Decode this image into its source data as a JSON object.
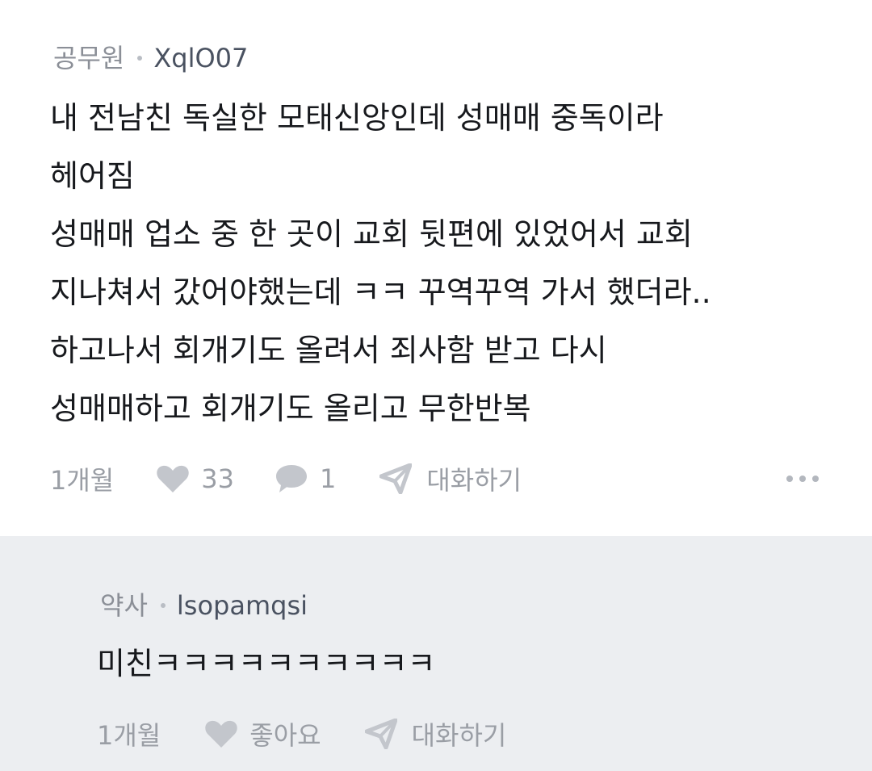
{
  "post": {
    "author_job": "공무원",
    "author_nick": "XqlO07",
    "lines": [
      "내 전남친 독실한 모태신앙인데 성매매 중독이라",
      "헤어짐",
      "성매매 업소 중 한 곳이 교회 뒷편에 있었어서 교회",
      "지나쳐서 갔어야했는데 ㅋㅋ 꾸역꾸역 가서 했더라..",
      "하고나서 회개기도 올려서 죄사함 받고 다시",
      "성매매하고 회개기도 올리고 무한반복"
    ],
    "time": "1개월",
    "likes": "33",
    "comments": "1",
    "chat_label": "대화하기",
    "icons": [
      "heart-icon",
      "comment-bubble-icon",
      "send-icon",
      "more-dots-icon"
    ]
  },
  "reply": {
    "author_job": "약사",
    "author_nick": "lsopamqsi",
    "text": "미친ㅋㅋㅋㅋㅋㅋㅋㅋㅋㅋ",
    "time": "1개월",
    "like_label": "좋아요",
    "chat_label": "대화하기",
    "icons": [
      "heart-icon",
      "send-icon"
    ]
  },
  "colors": {
    "background": "#ffffff",
    "reply_background": "#eceef1",
    "muted_text": "#9a9ea5",
    "body_text": "#17191d",
    "nickname": "#4a5261"
  }
}
